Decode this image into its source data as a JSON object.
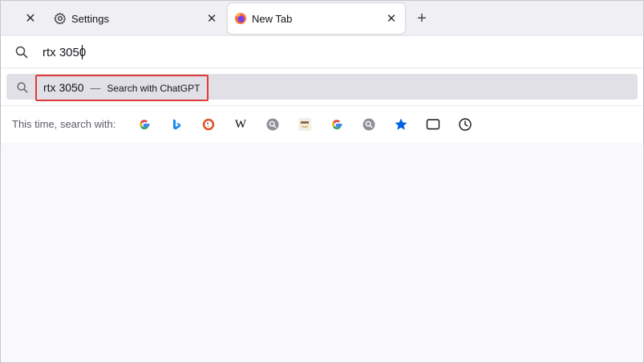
{
  "tabs": [
    {
      "label": "Settings",
      "icon": "gear-icon"
    },
    {
      "label": "New Tab",
      "icon": "firefox-icon"
    }
  ],
  "urlbar": {
    "value": "rtx 3050"
  },
  "result": {
    "query": "rtx 3050",
    "separator": "—",
    "action": "Search with ChatGPT"
  },
  "oneoffs": {
    "label": "This time, search with:",
    "engines": [
      "google-icon",
      "bing-icon",
      "duckduckgo-icon",
      "wikipedia-icon",
      "generic-search-icon",
      "amazon-icon",
      "google-icon",
      "generic-search-icon",
      "bookmarks-star-icon",
      "tabs-icon",
      "history-clock-icon"
    ]
  },
  "colors": {
    "highlight": "#e03a3a",
    "bookmark_star": "#0061e0",
    "google_blue": "#4285f4"
  }
}
